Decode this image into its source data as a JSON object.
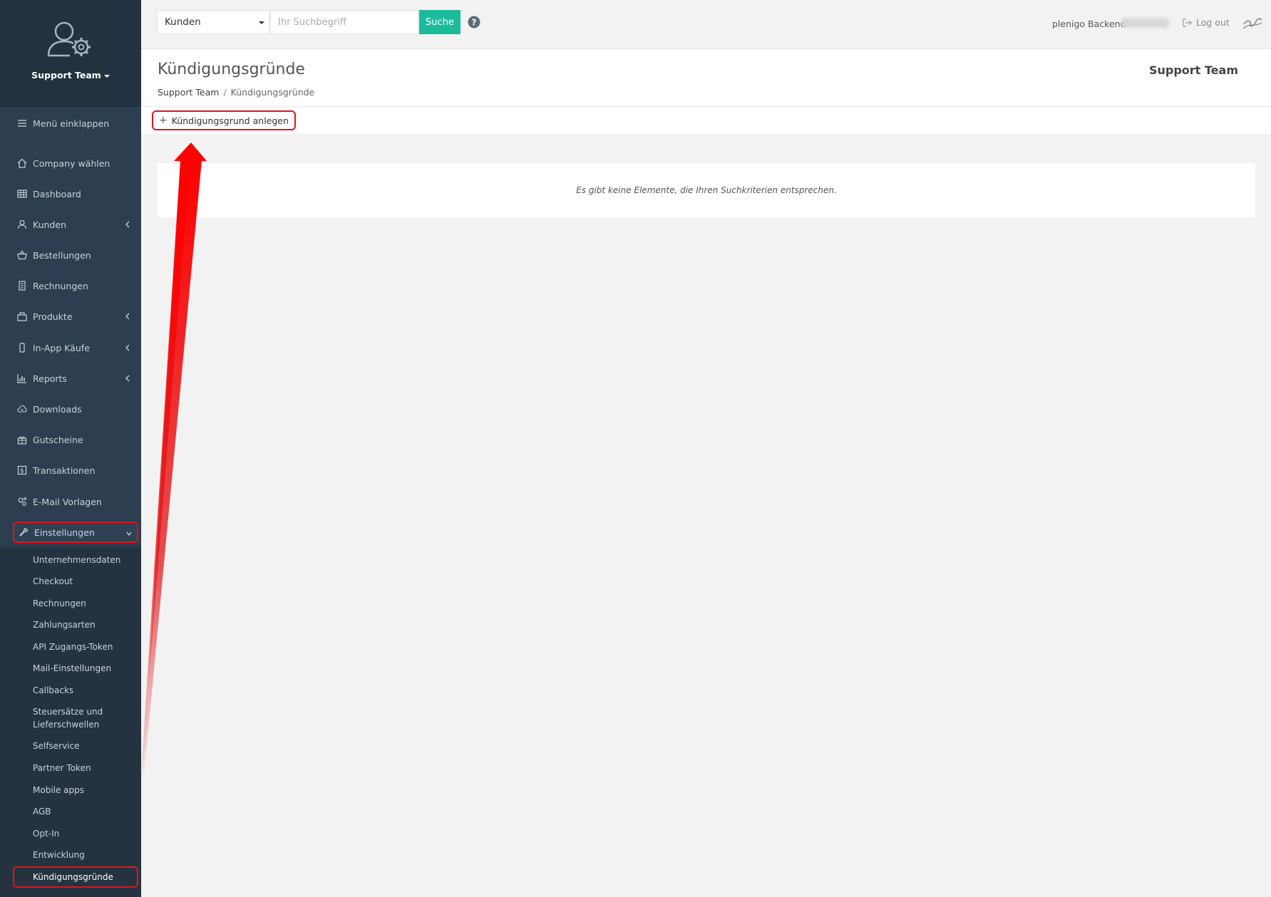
{
  "sidebar": {
    "team_name": "Support Team",
    "collapse_label": "Menü einklappen",
    "items": [
      {
        "label": "Company wählen",
        "icon": "home-icon"
      },
      {
        "label": "Dashboard",
        "icon": "grid-icon"
      },
      {
        "label": "Kunden",
        "icon": "user-icon"
      },
      {
        "label": "Bestellungen",
        "icon": "basket-icon"
      },
      {
        "label": "Rechnungen",
        "icon": "document-icon"
      },
      {
        "label": "Produkte",
        "icon": "products-icon"
      },
      {
        "label": "In-App Käufe",
        "icon": "mobile-icon"
      },
      {
        "label": "Reports",
        "icon": "bar-chart-icon"
      },
      {
        "label": "Downloads",
        "icon": "cloud-download-icon"
      },
      {
        "label": "Gutscheine",
        "icon": "gift-icon"
      },
      {
        "label": "Transaktionen",
        "icon": "dollar-icon"
      },
      {
        "label": "E-Mail Vorlagen",
        "icon": "cogs-icon"
      },
      {
        "label": "Einstellungen",
        "icon": "wrench-icon"
      }
    ],
    "submenu": [
      "Unternehmensdaten",
      "Checkout",
      "Rechnungen",
      "Zahlungsarten",
      "API Zugangs-Token",
      "Mail-Einstellungen",
      "Callbacks",
      "Steuersätze und Lieferschwellen",
      "Selfservice",
      "Partner Token",
      "Mobile apps",
      "AGB",
      "Opt-In",
      "Entwicklung",
      "Kündigungsgründe"
    ]
  },
  "topbar": {
    "search_scope": "Kunden",
    "search_placeholder": "Ihr Suchbegriff",
    "search_button": "Suche",
    "backend_label": "plenigo Backend",
    "logout_label": "Log out"
  },
  "page": {
    "title": "Kündigungsgründe",
    "breadcrumb_root": "Support Team",
    "breadcrumb_separator": "/",
    "breadcrumb_current": "Kündigungsgründe",
    "team_right": "Support Team",
    "add_button": "Kündigungsgrund anlegen",
    "empty_message": "Es gibt keine Elemente, die Ihren Suchkriterien entsprechen."
  },
  "colors": {
    "sidebar_bg": "#2c3e4f",
    "accent_green": "#1abc9c",
    "highlight_red": "#e0161a"
  }
}
